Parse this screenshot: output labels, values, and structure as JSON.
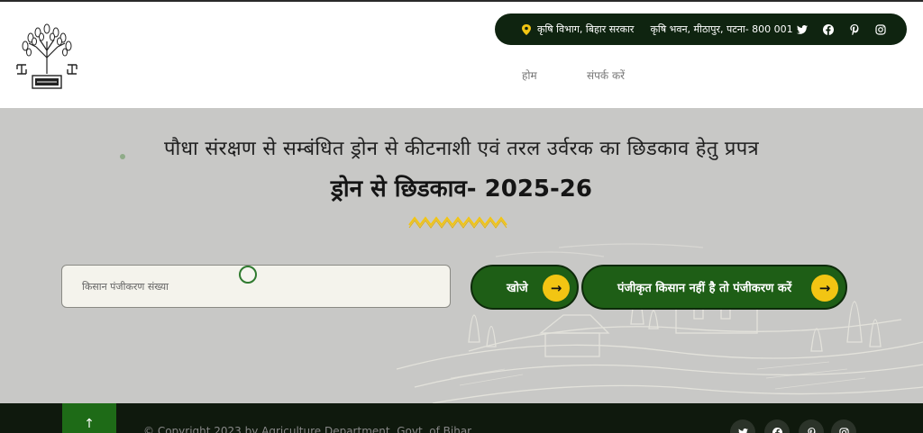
{
  "header": {
    "topbar": {
      "department": "कृषि विभाग, बिहार सरकार",
      "address": "कृषि भवन, मीठापुर, पटना- 800 001",
      "social": [
        "twitter-icon",
        "facebook-icon",
        "pinterest-icon",
        "instagram-icon"
      ]
    },
    "nav": {
      "home": "होम",
      "contact": "संपर्क करें"
    }
  },
  "hero": {
    "headline": "पौधा संरक्षण से सम्बंधित ड्रोन से कीटनाशी एवं तरल उर्वरक का छिडकाव हेतु प्रपत्र",
    "subtitle": "ड्रोन से छिडकाव- 2025-26",
    "search": {
      "placeholder": "किसान पंजीकरण संख्या",
      "value": ""
    },
    "search_button": "खोजे",
    "register_button": "पंजीकृत किसान नहीं है तो पंजीकरण करें",
    "arrow": "→"
  },
  "footer": {
    "scroll_top": "↑",
    "copyright": "© Copyright 2023 by Agriculture Department, Govt. of Bihar"
  },
  "colors": {
    "dark_green": "#0f2410",
    "button_green": "#1e5e16",
    "accent_yellow": "#f2c513",
    "hero_bg": "#c8c8c6"
  }
}
